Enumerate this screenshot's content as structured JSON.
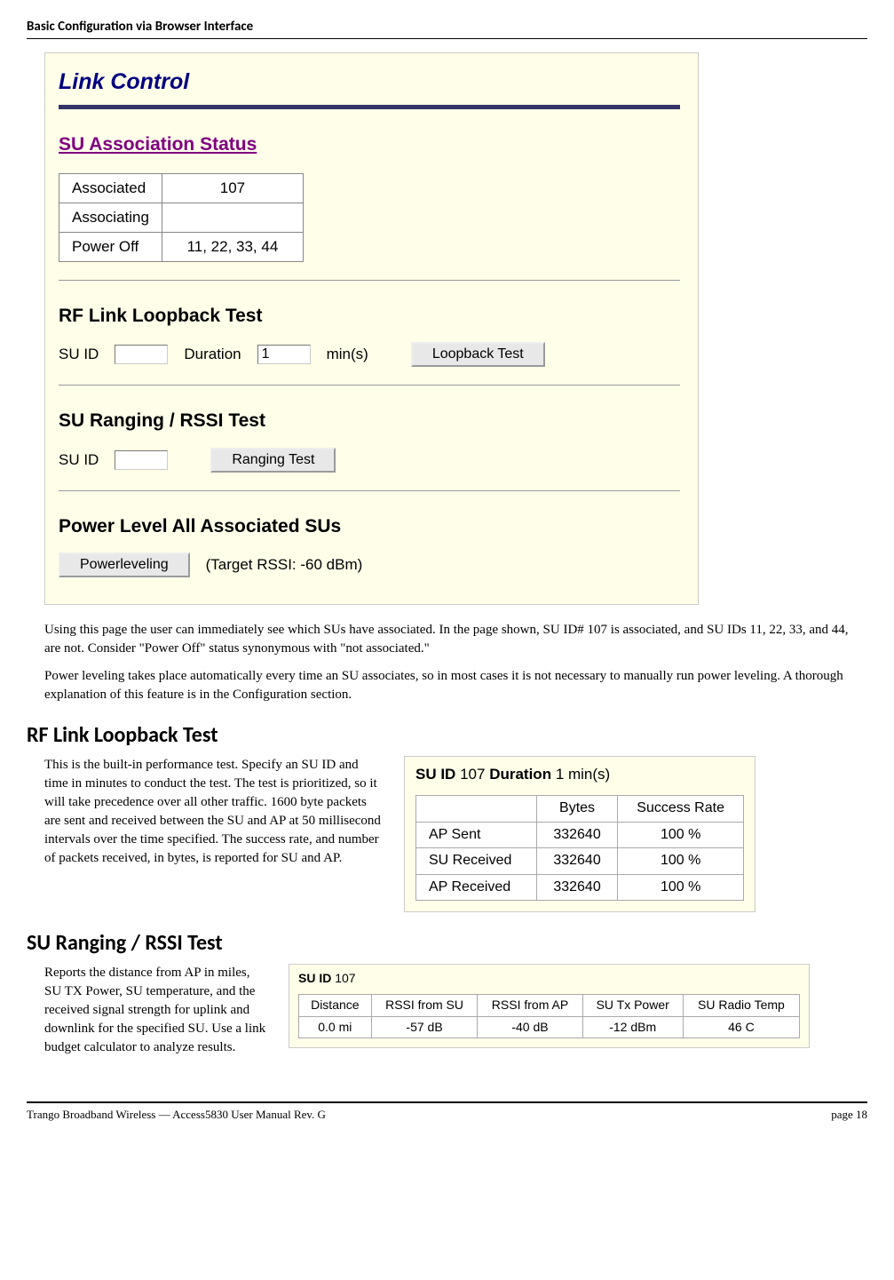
{
  "header": "Basic Configuration via Browser Interface",
  "panel": {
    "title": "Link Control",
    "su_assoc": {
      "heading": "SU Association Status",
      "rows": [
        {
          "label": "Associated",
          "value": "107"
        },
        {
          "label": "Associating",
          "value": ""
        },
        {
          "label": "Power Off",
          "value": "11, 22, 33, 44"
        }
      ]
    },
    "loopback": {
      "heading": "RF Link Loopback Test",
      "suid_label": "SU ID",
      "suid_value": "",
      "duration_label": "Duration",
      "duration_value": "1",
      "unit": "min(s)",
      "button": "Loopback Test"
    },
    "ranging": {
      "heading": "SU Ranging / RSSI Test",
      "suid_label": "SU ID",
      "suid_value": "",
      "button": "Ranging Test"
    },
    "powerlevel": {
      "heading": "Power Level All Associated SUs",
      "button": "Powerleveling",
      "note": "(Target RSSI: -60 dBm)"
    }
  },
  "body": {
    "para1": "Using this page the user can immediately see which SUs have associated.  In the page shown, SU ID# 107 is associated, and SU IDs 11, 22, 33, and 44, are not.  Consider \"Power Off\" status synonymous with \"not associated.\"",
    "para2": "Power leveling takes place automatically every time an SU associates, so in most cases it is not necessary to manually run power leveling.  A thorough explanation of this feature is in the Configuration section."
  },
  "loopback_section": {
    "heading": "RF Link Loopback Test",
    "text": "This is the built-in performance test.  Specify an SU ID and time in minutes to conduct the test.  The test is prioritized, so it will take precedence over all other traffic.  1600 byte packets are sent and received between the SU and AP at 50 millisecond intervals over the time specified. The success rate, and number of packets received, in bytes, is reported for SU and AP.",
    "result": {
      "suid_label": "SU ID",
      "suid": "107",
      "duration_label": "Duration",
      "duration": "1 min(s)",
      "columns": [
        "",
        "Bytes",
        "Success Rate"
      ],
      "rows": [
        {
          "label": "AP Sent",
          "bytes": "332640",
          "rate": "100 %"
        },
        {
          "label": "SU Received",
          "bytes": "332640",
          "rate": "100 %"
        },
        {
          "label": "AP Received",
          "bytes": "332640",
          "rate": "100 %"
        }
      ]
    }
  },
  "ranging_section": {
    "heading": "SU Ranging / RSSI Test",
    "text": "Reports the distance from AP in miles, SU TX Power, SU temperature, and the received signal strength for uplink and downlink for the specified SU.  Use a link budget calculator to analyze results.",
    "result": {
      "suid_label": "SU ID",
      "suid": "107",
      "columns": [
        "Distance",
        "RSSI from SU",
        "RSSI from AP",
        "SU Tx Power",
        "SU Radio Temp"
      ],
      "values": [
        "0.0 mi",
        "-57 dB",
        "-40 dB",
        "-12 dBm",
        "46 C"
      ]
    }
  },
  "footer": {
    "left": "Trango Broadband Wireless — Access5830 User Manual  Rev. G",
    "right": "page 18"
  }
}
